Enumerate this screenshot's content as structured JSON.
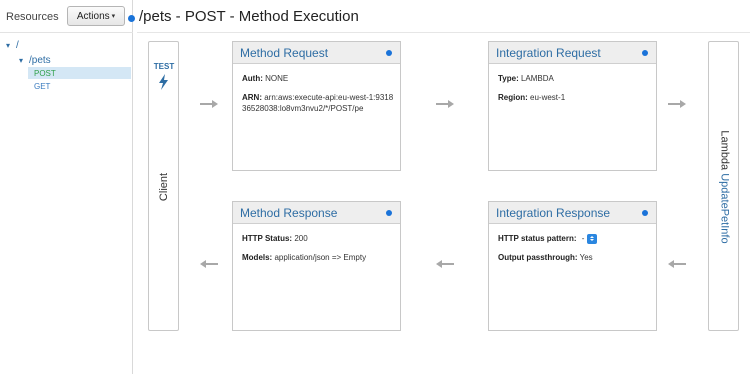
{
  "sidebar": {
    "title": "Resources",
    "actions_label": "Actions",
    "tree": {
      "root": "/",
      "child": "/pets",
      "methods": [
        "POST",
        "GET"
      ]
    }
  },
  "header": {
    "title": "/pets - POST - Method Execution"
  },
  "client": {
    "test_label": "TEST",
    "label": "Client"
  },
  "lambda": {
    "prefix": "Lambda",
    "function": "UpdatePetInfo"
  },
  "method_request": {
    "title": "Method Request",
    "auth_label": "Auth:",
    "auth_value": "NONE",
    "arn_label": "ARN:",
    "arn_value": "arn:aws:execute-api:eu-west-1:931836528038:lo8vm3nvu2/*/POST/pe"
  },
  "integration_request": {
    "title": "Integration Request",
    "type_label": "Type:",
    "type_value": "LAMBDA",
    "region_label": "Region:",
    "region_value": "eu-west-1"
  },
  "method_response": {
    "title": "Method Response",
    "status_label": "HTTP Status:",
    "status_value": "200",
    "models_label": "Models:",
    "models_value": "application/json => Empty"
  },
  "integration_response": {
    "title": "Integration Response",
    "pattern_label": "HTTP status pattern:",
    "pattern_value": "-",
    "passthrough_label": "Output passthrough:",
    "passthrough_value": "Yes"
  },
  "colors": {
    "accent": "#2e6da4",
    "status_dot": "#1a73d9",
    "selected_bg": "#d4e7f5",
    "post_text": "#2fa04a",
    "arrow": "#a8a8a8"
  }
}
